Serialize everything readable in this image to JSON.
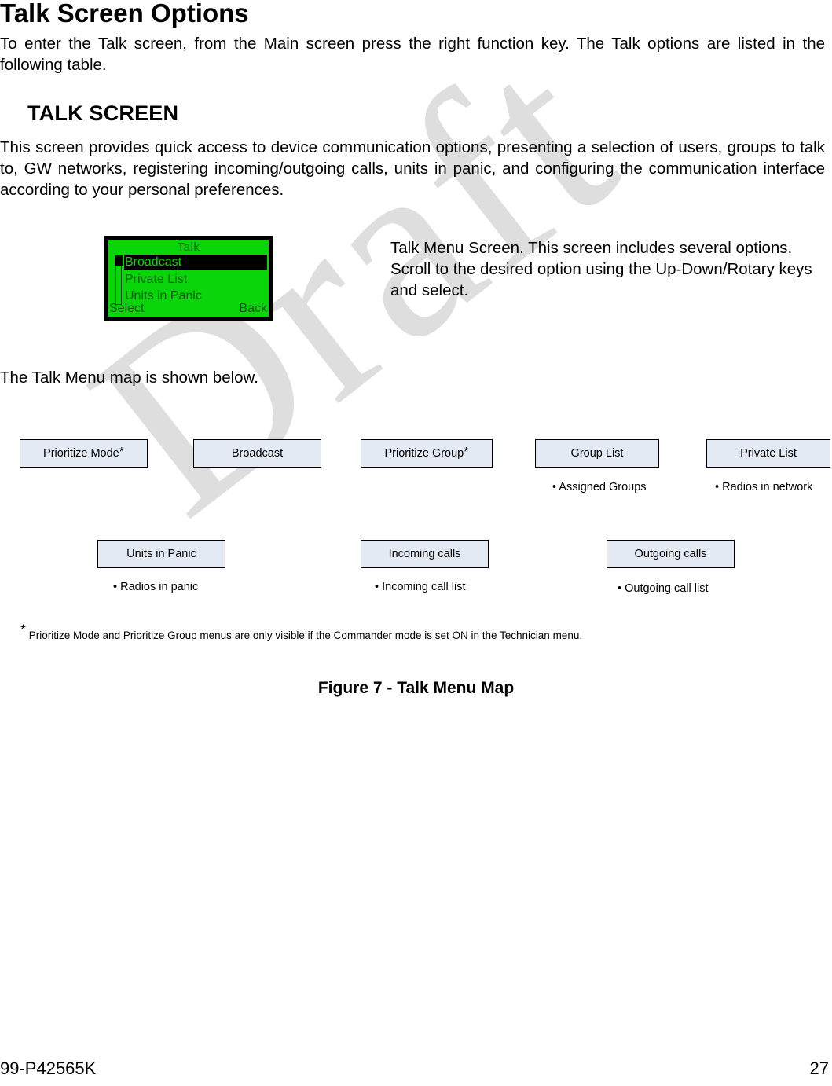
{
  "document": {
    "title": "Talk Screen Options",
    "intro_paragraph": "To enter the Talk screen, from the Main screen press the right function key. The Talk options are listed in the following table.",
    "section_heading": "TALK SCREEN",
    "section_paragraph": "This screen provides quick access to device communication options, presenting a selection of users, groups to talk to, GW networks, registering incoming/outgoing calls, units in panic, and configuring the communication interface according to your personal preferences.",
    "map_intro": "The Talk Menu map is shown below."
  },
  "lcd_screen": {
    "title": "Talk",
    "items": [
      {
        "label": "Broadcast",
        "selected": true
      },
      {
        "label": "Private List",
        "selected": false
      },
      {
        "label": "Units in Panic",
        "selected": false
      }
    ],
    "softkey_left": "Select",
    "softkey_right": "Back",
    "background_color": "#0AD40A",
    "text_color": "#0A5C0A"
  },
  "lcd_caption": "Talk Menu Screen.  This screen includes several options. Scroll to the desired option using the Up-Down/Rotary keys and select.",
  "menu_map": {
    "box_fill_color": "#E4EAF4",
    "row1": [
      {
        "label": "Prioritize Mode",
        "star": "*",
        "bullet": ""
      },
      {
        "label": "Broadcast",
        "star": "",
        "bullet": ""
      },
      {
        "label": "Prioritize Group",
        "star": "*",
        "bullet": ""
      },
      {
        "label": "Group List",
        "star": "",
        "bullet": "• Assigned Groups"
      },
      {
        "label": "Private List",
        "star": "",
        "bullet": "• Radios in network"
      }
    ],
    "row2": [
      {
        "label": "Units in Panic",
        "star": "",
        "bullet": "• Radios in panic"
      },
      {
        "label": "Incoming calls",
        "star": "",
        "bullet": "• Incoming call list"
      },
      {
        "label": "Outgoing calls",
        "star": "",
        "bullet": "• Outgoing call list"
      }
    ],
    "footnote_star": "*",
    "footnote_text": " Prioritize Mode and Prioritize Group menus are only visible if the Commander mode is set ON in the Technician menu.",
    "figure_caption": "Figure 7 - Talk Menu Map"
  },
  "watermark": {
    "text": "Draft",
    "color": "#DEDEDE"
  },
  "footer": {
    "document_number": "99-P42565K",
    "page_number": "27"
  }
}
